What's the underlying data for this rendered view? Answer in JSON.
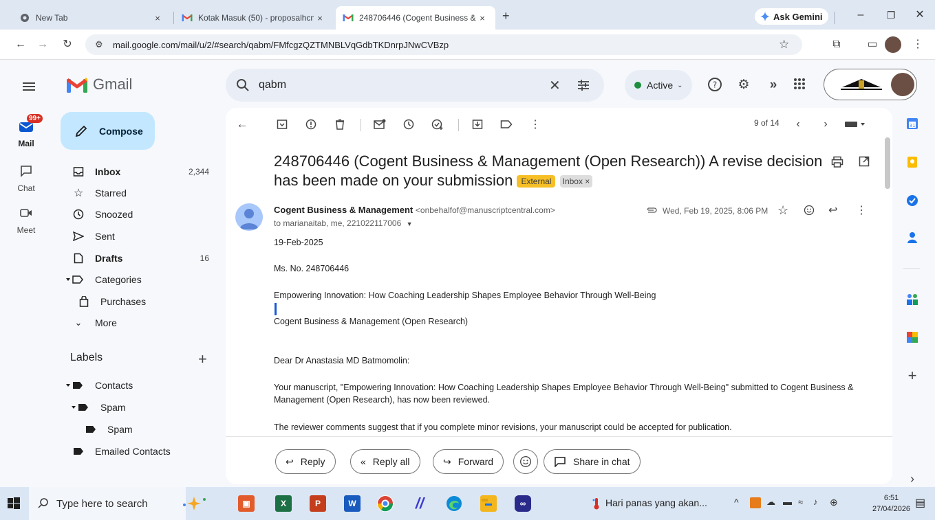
{
  "browser": {
    "tabs": [
      {
        "title": "New Tab",
        "close": "×"
      },
      {
        "title": "Kotak Masuk (50) - proposalhcn",
        "close": "×"
      },
      {
        "title": "248706446 (Cogent Business &",
        "close": "×"
      }
    ],
    "new_tab": "+",
    "ask_gemini": "Ask Gemini",
    "url": "mail.google.com/mail/u/2/#search/qabm/FMfcgzQZTMNBLVqGdbTKDnrpJNwCVBzp"
  },
  "gmail": {
    "brand": "Gmail",
    "search_value": "qabm",
    "status": "Active",
    "rail": [
      {
        "label": "Mail",
        "badge": "99+"
      },
      {
        "label": "Chat"
      },
      {
        "label": "Meet"
      }
    ],
    "compose": "Compose",
    "nav": [
      {
        "label": "Inbox",
        "count": "2,344"
      },
      {
        "label": "Starred",
        "count": ""
      },
      {
        "label": "Snoozed",
        "count": ""
      },
      {
        "label": "Sent",
        "count": ""
      },
      {
        "label": "Drafts",
        "count": "16"
      },
      {
        "label": "Categories",
        "count": ""
      },
      {
        "label": "Purchases",
        "count": ""
      },
      {
        "label": "More",
        "count": ""
      }
    ],
    "labels_header": "Labels",
    "labels": [
      "Contacts",
      "Spam",
      "Spam",
      "Emailed Contacts"
    ]
  },
  "email": {
    "pager": "9 of 14",
    "subject": "248706446 (Cogent Business & Management (Open Research)) A revise decision has been made on your submission",
    "badge_external": "External",
    "badge_inbox": "Inbox ×",
    "sender_name": "Cogent Business & Management",
    "sender_email": "<onbehalfof@manuscriptcentral.com>",
    "recipients": "to marianaitab, me, 221022117006",
    "timestamp": "Wed, Feb 19, 2025, 8:06 PM",
    "body": {
      "date": "19-Feb-2025",
      "ms_no": "Ms. No. 248706446",
      "title": "Empowering Innovation: How Coaching Leadership  Shapes Employee Behavior Through Well-Being",
      "journal": "Cogent Business & Management (Open Research)",
      "greeting": "Dear Dr Anastasia MD  Batmomolin:",
      "para1a": "Your manuscript, \"Empowering Innovation: How Coaching Leadership  Shapes Employee Behavior Through Well-Being\" submitted to Cogent Business &",
      "para1b": "Management (Open Research), has now been reviewed.",
      "para2": "The reviewer comments suggest that if you complete minor revisions, your manuscript could be accepted for publication."
    },
    "actions": {
      "reply": "Reply",
      "reply_all": "Reply all",
      "forward": "Forward",
      "share": "Share in chat"
    }
  },
  "taskbar": {
    "search_placeholder": "Type here to search",
    "weather": "Hari panas yang akan...",
    "time": "6:51",
    "date": "27/04/2026"
  },
  "colors": {
    "compose_bg": "#c2e7ff",
    "active_dot": "#1e8e3e",
    "external_badge": "#f6bf26",
    "mail_badge": "#d93025"
  }
}
